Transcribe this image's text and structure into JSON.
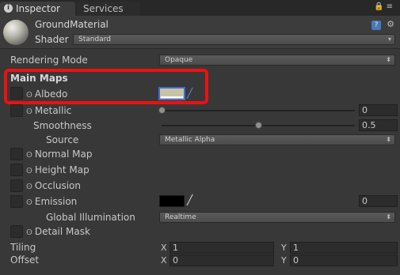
{
  "tabs": [
    {
      "label": "Inspector",
      "icon": "info-icon",
      "active": true
    },
    {
      "label": "Services",
      "active": false
    }
  ],
  "header": {
    "material_name": "GroundMaterial",
    "shader_label": "Shader",
    "shader_value": "Standard"
  },
  "rendering_mode": {
    "label": "Rendering Mode",
    "value": "Opaque"
  },
  "main_maps": {
    "title": "Main Maps",
    "albedo": {
      "label": "Albedo",
      "color": "#c8c3a4"
    },
    "metallic": {
      "label": "Metallic",
      "value": "0",
      "level": 0
    },
    "smoothness": {
      "label": "Smoothness",
      "value": "0.5",
      "level": 0.5
    },
    "source": {
      "label": "Source",
      "value": "Metallic Alpha"
    },
    "normal_map": {
      "label": "Normal Map"
    },
    "height_map": {
      "label": "Height Map"
    },
    "occlusion": {
      "label": "Occlusion"
    },
    "emission": {
      "label": "Emission",
      "value": "0",
      "color": "#000000"
    },
    "global_illumination": {
      "label": "Global Illumination",
      "value": "Realtime"
    },
    "detail_mask": {
      "label": "Detail Mask"
    }
  },
  "tiling": {
    "label": "Tiling",
    "x_label": "X",
    "x": "1",
    "y_label": "Y",
    "y": "1"
  },
  "offset": {
    "label": "Offset",
    "x_label": "X",
    "x": "0",
    "y_label": "Y",
    "y": "0"
  },
  "colors": {
    "highlight": "#ee1111",
    "accent": "#3d6bd6"
  }
}
